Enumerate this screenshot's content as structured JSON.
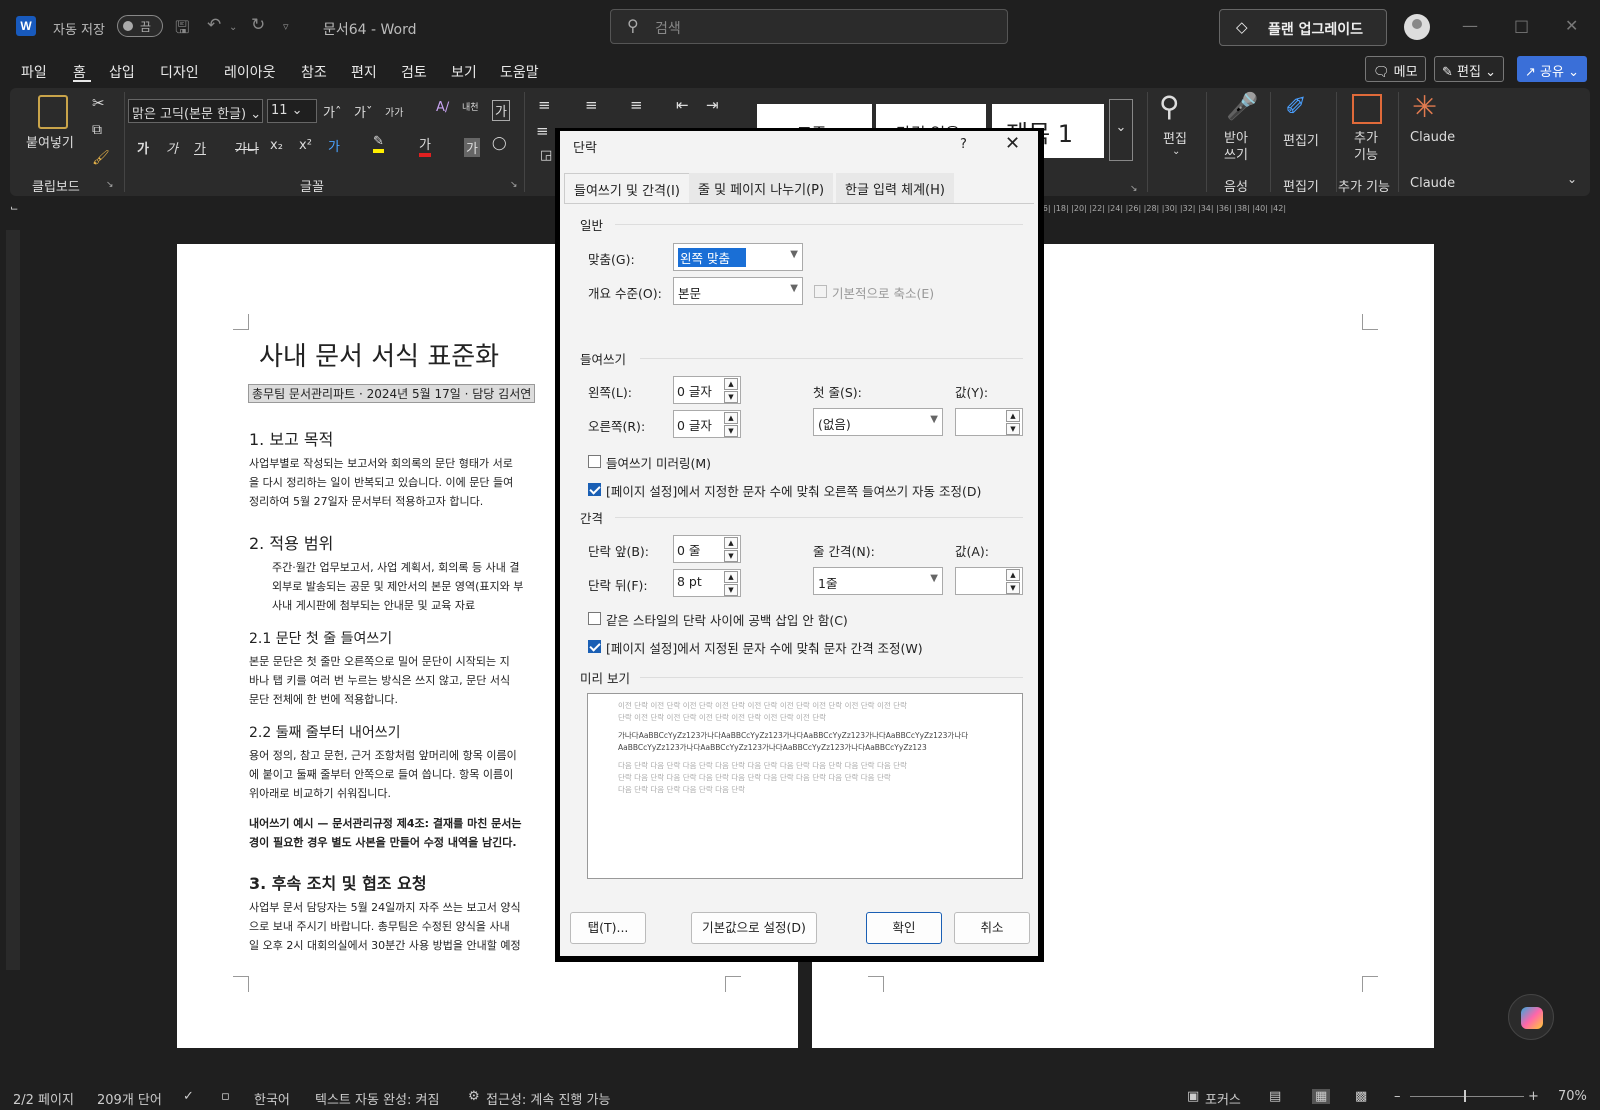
{
  "app": {
    "autosave_label": "자동 저장",
    "autosave_state": "끔",
    "doc_title": "문서64  -  Word",
    "search_placeholder": "검색",
    "upgrade_label": "플랜 업그레이드"
  },
  "menu": {
    "tabs": [
      "파일",
      "홈",
      "삽입",
      "디자인",
      "레이아웃",
      "참조",
      "편지",
      "검토",
      "보기",
      "도움말"
    ],
    "memo": "메모",
    "edit": "편집",
    "share": "공유"
  },
  "ribbon": {
    "paste": "붙여넣기",
    "clipboard_group": "클립보드",
    "font_name": "맑은 고딕(본문 한글)",
    "font_size": "11",
    "font_group": "글꼴",
    "styles": [
      "표준",
      "간격 없음",
      "제목 1"
    ],
    "find_label": "편집",
    "dictate_label": "받아\n쓰기",
    "voice_group": "음성",
    "editor_label": "편집기",
    "editor_group": "편집기",
    "addins_label": "추가\n기능",
    "addins_group": "추가 기능",
    "claude_label": "Claude",
    "claude_group": "Claude"
  },
  "ruler": {
    "numbers": "|16| |18| |20| |22| |24| |26| |28| |30| |32| |34| |36| |38| |40| |42|"
  },
  "document": {
    "title": "사내 문서 서식 표준화",
    "meta": "총무팀 문서관리파트 · 2024년 5월 17일 · 담당 김서연",
    "h_purpose": "1. 보고 목적",
    "p_purpose_1": "사업부별로 작성되는 보고서와 회의록의 문단 형태가 서로",
    "p_purpose_2": "을 다시 정리하는 일이 반복되고 있습니다. 이에 문단 들여",
    "p_purpose_3": "정리하여 5월 27일자 문서부터 적용하고자 합니다.",
    "h_scope": "2. 적용 범위",
    "scope_1": "주간·월간 업무보고서, 사업 계획서, 회의록 등 사내 결",
    "scope_2": "외부로 발송되는 공문 및 제안서의 본문 영역(표지와 부",
    "scope_3": "사내 게시판에 첨부되는 안내문 및 교육 자료",
    "h_first": "2.1 문단 첫 줄 들여쓰기",
    "first_1": "본문 문단은 첫 줄만 오른쪽으로 밀어 문단이 시작되는 지",
    "first_2": "바나 탭 키를 여러 번 누르는 방식은 쓰지 않고, 문단 서식",
    "first_3": "문단 전체에 한 번에 적용합니다.",
    "h_hang": "2.2 둘째 줄부터 내어쓰기",
    "hang_1": "용어 정의, 참고 문헌, 근거 조항처럼 앞머리에 항목 이름이",
    "hang_2": "에 붙이고 둘째 줄부터 안쪽으로 들여 씁니다. 항목 이름이",
    "hang_3": "위아래로 비교하기 쉬워집니다.",
    "example_1": "내어쓰기 예시 — 문서관리규정 제4조: 결재를 마친 문서는",
    "example_2": "경이 필요한 경우 별도 사본을 만들어 수정 내역을 남긴다.",
    "h_follow": "3. 후속 조치 및 협조 요청",
    "follow_1": "사업부 문서 담당자는 5월 24일까지 자주 쓰는 보고서 양식",
    "follow_2": "으로 보내 주시기 바랍니다. 총무팀은 수정된 양식을 사내",
    "follow_3": "일 오후 2시 대회의실에서 30분간 사용 방법을 안내할 예정"
  },
  "dialog": {
    "title": "단락",
    "help": "?",
    "tabs": [
      "들여쓰기 및 간격(I)",
      "줄 및 페이지 나누기(P)",
      "한글 입력 체계(H)"
    ],
    "general": "일반",
    "alignment_label": "맞춤(G):",
    "alignment_value": "왼쪽 맞춤",
    "outline_label": "개요 수준(O):",
    "outline_value": "본문",
    "collapse_label": "기본적으로 축소(E)",
    "indent": "들여쓰기",
    "left_label": "왼쪽(L):",
    "left_value": "0 글자",
    "right_label": "오른쪽(R):",
    "right_value": "0 글자",
    "special_label": "첫 줄(S):",
    "special_value": "(없음)",
    "by_label": "값(Y):",
    "mirror_label": "들여쓰기 미러링(M)",
    "auto_right_label": "[페이지 설정]에서 지정한 문자 수에 맞춰 오른쪽 들여쓰기 자동 조정(D)",
    "spacing": "간격",
    "before_label": "단락 앞(B):",
    "before_value": "0 줄",
    "after_label": "단락 뒤(F):",
    "after_value": "8 pt",
    "line_label": "줄 간격(N):",
    "line_value": "1줄",
    "at_label": "값(A):",
    "no_space_label": "같은 스타일의 단락 사이에 공백 삽입 안 함(C)",
    "snap_label": "[페이지 설정]에서 지정된 문자 수에 맞춰 문자 간격 조정(W)",
    "preview": "미리 보기",
    "preview_prev_1": "이전 단락 이전 단락 이전 단락 이전 단락 이전 단락 이전 단락 이전 단락 이전 단락 이전 단락",
    "preview_prev_2": "단락 이전 단락 이전 단락 이전 단락 이전 단락 이전 단락 이전 단락",
    "preview_sample_1": "가나다AaBBCcYyZz123가나다AaBBCcYyZz123가나다AaBBCcYyZz123가나다AaBBCcYyZz123가나다",
    "preview_sample_2": "AaBBCcYyZz123가나다AaBBCcYyZz123가나다AaBBCcYyZz123가나다AaBBCcYyZz123",
    "preview_next_1": "다음 단락 다음 단락 다음 단락 다음 단락 다음 단락 다음 단락 다음 단락 다음 단락 다음 단락",
    "preview_next_2": "단락 다음 단락 다음 단락 다음 단락 다음 단락 다음 단락 다음 단락 다음 단락 다음 단락",
    "preview_next_3": "다음 단락 다음 단락 다음 단락 다음 단락",
    "tabs_btn": "탭(T)...",
    "default_btn": "기본값으로 설정(D)",
    "ok_btn": "확인",
    "cancel_btn": "취소"
  },
  "status": {
    "page": "2/2 페이지",
    "words": "209개 단어",
    "language": "한국어",
    "autocomplete": "텍스트 자동 완성: 켜짐",
    "accessibility": "접근성: 계속 진행 가능",
    "focus": "포커스",
    "zoom": "70%"
  }
}
